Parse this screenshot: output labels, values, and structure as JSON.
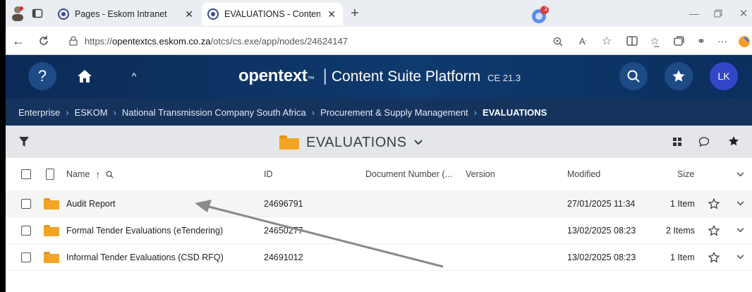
{
  "browser": {
    "tabs": [
      {
        "title": "Pages - Eskom Intranet",
        "active": false
      },
      {
        "title": "EVALUATIONS - Content Suite Pla",
        "active": true
      }
    ],
    "copilot_badge": "2",
    "url_scheme": "https://",
    "url_host": "opentextcs.eskom.co.za",
    "url_path": "/otcs/cs.exe/app/nodes/24624147"
  },
  "app": {
    "logo": "opentext",
    "tm": "™",
    "product": "Content Suite Platform",
    "version": "CE 21.3",
    "help_label": "?",
    "user_initials": "LK",
    "colors": {
      "header": "#0f3a6e",
      "breadcrumb": "#16335d",
      "folder": "#f2a523",
      "avatar": "#3346c9"
    }
  },
  "breadcrumb": [
    "Enterprise",
    "ESKOM",
    "National Transmission Company South Africa",
    "Procurement & Supply Management",
    "EVALUATIONS"
  ],
  "folder_title": "EVALUATIONS",
  "table": {
    "columns": {
      "name": "Name",
      "id": "ID",
      "docnum": "Document Number (...",
      "version": "Version",
      "modified": "Modified",
      "size": "Size"
    },
    "rows": [
      {
        "name": "Audit Report",
        "id": "24696791",
        "docnum": "",
        "version": "",
        "modified": "27/01/2025 11:34",
        "size": "1 Item"
      },
      {
        "name": "Formal Tender Evaluations (eTendering)",
        "id": "24650277",
        "docnum": "",
        "version": "",
        "modified": "13/02/2025 08:23",
        "size": "2 Items"
      },
      {
        "name": "Informal Tender Evaluations (CSD RFQ)",
        "id": "24691012",
        "docnum": "",
        "version": "",
        "modified": "13/02/2025 08:23",
        "size": "1 Item"
      }
    ]
  }
}
